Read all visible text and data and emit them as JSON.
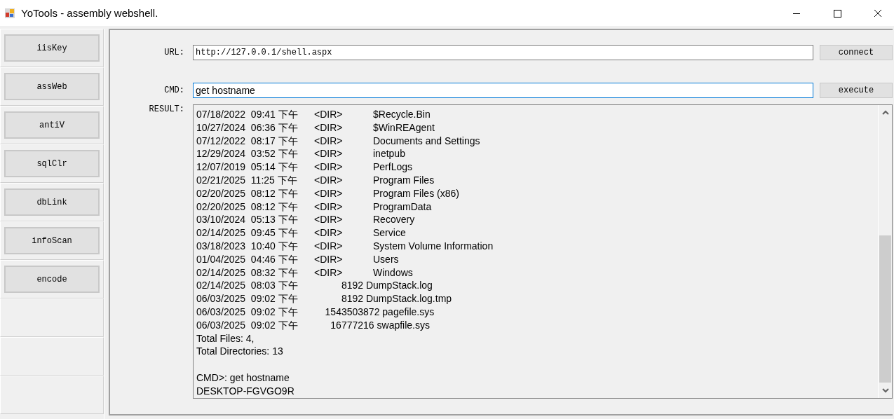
{
  "window": {
    "title": "YoTools - assembly webshell."
  },
  "sidebar": {
    "items": [
      {
        "label": "iisKey"
      },
      {
        "label": "assWeb"
      },
      {
        "label": "antiV"
      },
      {
        "label": "sqlClr"
      },
      {
        "label": "dbLink"
      },
      {
        "label": "infoScan"
      },
      {
        "label": "encode"
      }
    ]
  },
  "url": {
    "label": "URL:",
    "value": "http://127.0.0.1/shell.aspx",
    "button": "connect"
  },
  "cmd": {
    "label": "CMD:",
    "value": "get hostname",
    "focused": true,
    "button": "execute"
  },
  "result": {
    "label": "RESULT:",
    "lines": [
      {
        "text": "07/18/2022  09:41 下午\t<DIR>\t$Recycle.Bin"
      },
      {
        "text": "10/27/2024  06:36 下午\t<DIR>\t$WinREAgent"
      },
      {
        "text": "07/12/2022  08:17 下午\t<DIR>\tDocuments and Settings"
      },
      {
        "text": "12/29/2024  03:52 下午\t<DIR>\tinetpub"
      },
      {
        "text": "12/07/2019  05:14 下午\t<DIR>\tPerfLogs"
      },
      {
        "text": "02/21/2025  11:25 下午\t<DIR>\tProgram Files"
      },
      {
        "text": "02/20/2025  08:12 下午\t<DIR>\tProgram Files (x86)"
      },
      {
        "text": "02/20/2025  08:12 下午\t<DIR>\tProgramData"
      },
      {
        "text": "03/10/2024  05:13 下午\t<DIR>\tRecovery"
      },
      {
        "text": "02/14/2025  09:45 下午\t<DIR>\tService"
      },
      {
        "text": "03/18/2023  10:40 下午\t<DIR>\tSystem Volume Information"
      },
      {
        "text": "01/04/2025  04:46 下午\t<DIR>\tUsers"
      },
      {
        "text": "02/14/2025  08:32 下午\t<DIR>\tWindows"
      },
      {
        "text": "02/14/2025  08:03 下午\t          8192 DumpStack.log"
      },
      {
        "text": "06/03/2025  09:02 下午\t          8192 DumpStack.log.tmp"
      },
      {
        "text": "06/03/2025  09:02 下午\t    1543503872 pagefile.sys"
      },
      {
        "text": "06/03/2025  09:02 下午\t      16777216 swapfile.sys"
      },
      {
        "text": "Total Files: 4,"
      },
      {
        "text": "Total Directories: 13"
      },
      {
        "text": "CMD>: get hostname",
        "blank_line_before": true
      },
      {
        "text": "DESKTOP-FGVGO9R"
      }
    ]
  }
}
